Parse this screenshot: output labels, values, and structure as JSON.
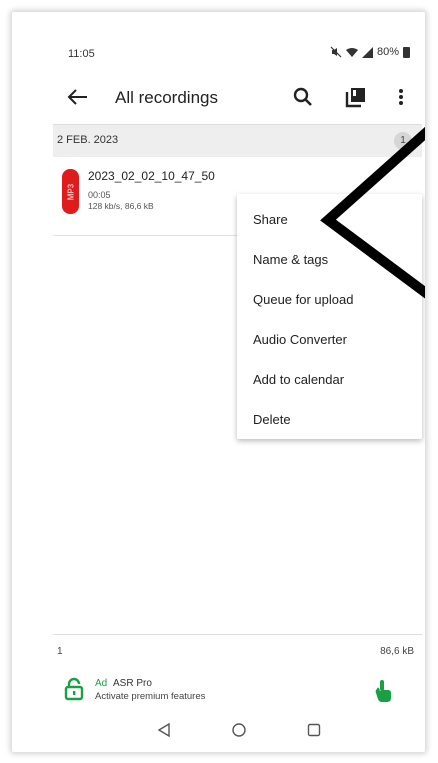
{
  "status_bar": {
    "time": "11:05",
    "battery": "80%"
  },
  "toolbar": {
    "title": "All recordings",
    "back_icon": "arrow-left-icon",
    "search_icon": "search-icon",
    "library_icon": "library-icon",
    "overflow_icon": "more-vert-icon"
  },
  "group": {
    "date": "2 FEB. 2023",
    "count": "1"
  },
  "recording": {
    "format": "MP3",
    "name": "2023_02_02_10_47_50",
    "duration": "00:05",
    "meta": "128 kb/s, 86,6 kB"
  },
  "context_menu": {
    "items": [
      {
        "label": "Share"
      },
      {
        "label": "Name & tags"
      },
      {
        "label": "Queue for upload"
      },
      {
        "label": "Audio Converter"
      },
      {
        "label": "Add to calendar"
      },
      {
        "label": "Delete"
      }
    ]
  },
  "footer": {
    "count": "1",
    "total_size": "86,6 kB"
  },
  "ad": {
    "tag": "Ad",
    "title": "ASR Pro",
    "subtitle": "Activate premium features",
    "left_icon": "lock-icon",
    "right_icon": "hand-icon"
  },
  "colors": {
    "accent": "#e01b1b",
    "ad_green": "#1a9f43"
  }
}
